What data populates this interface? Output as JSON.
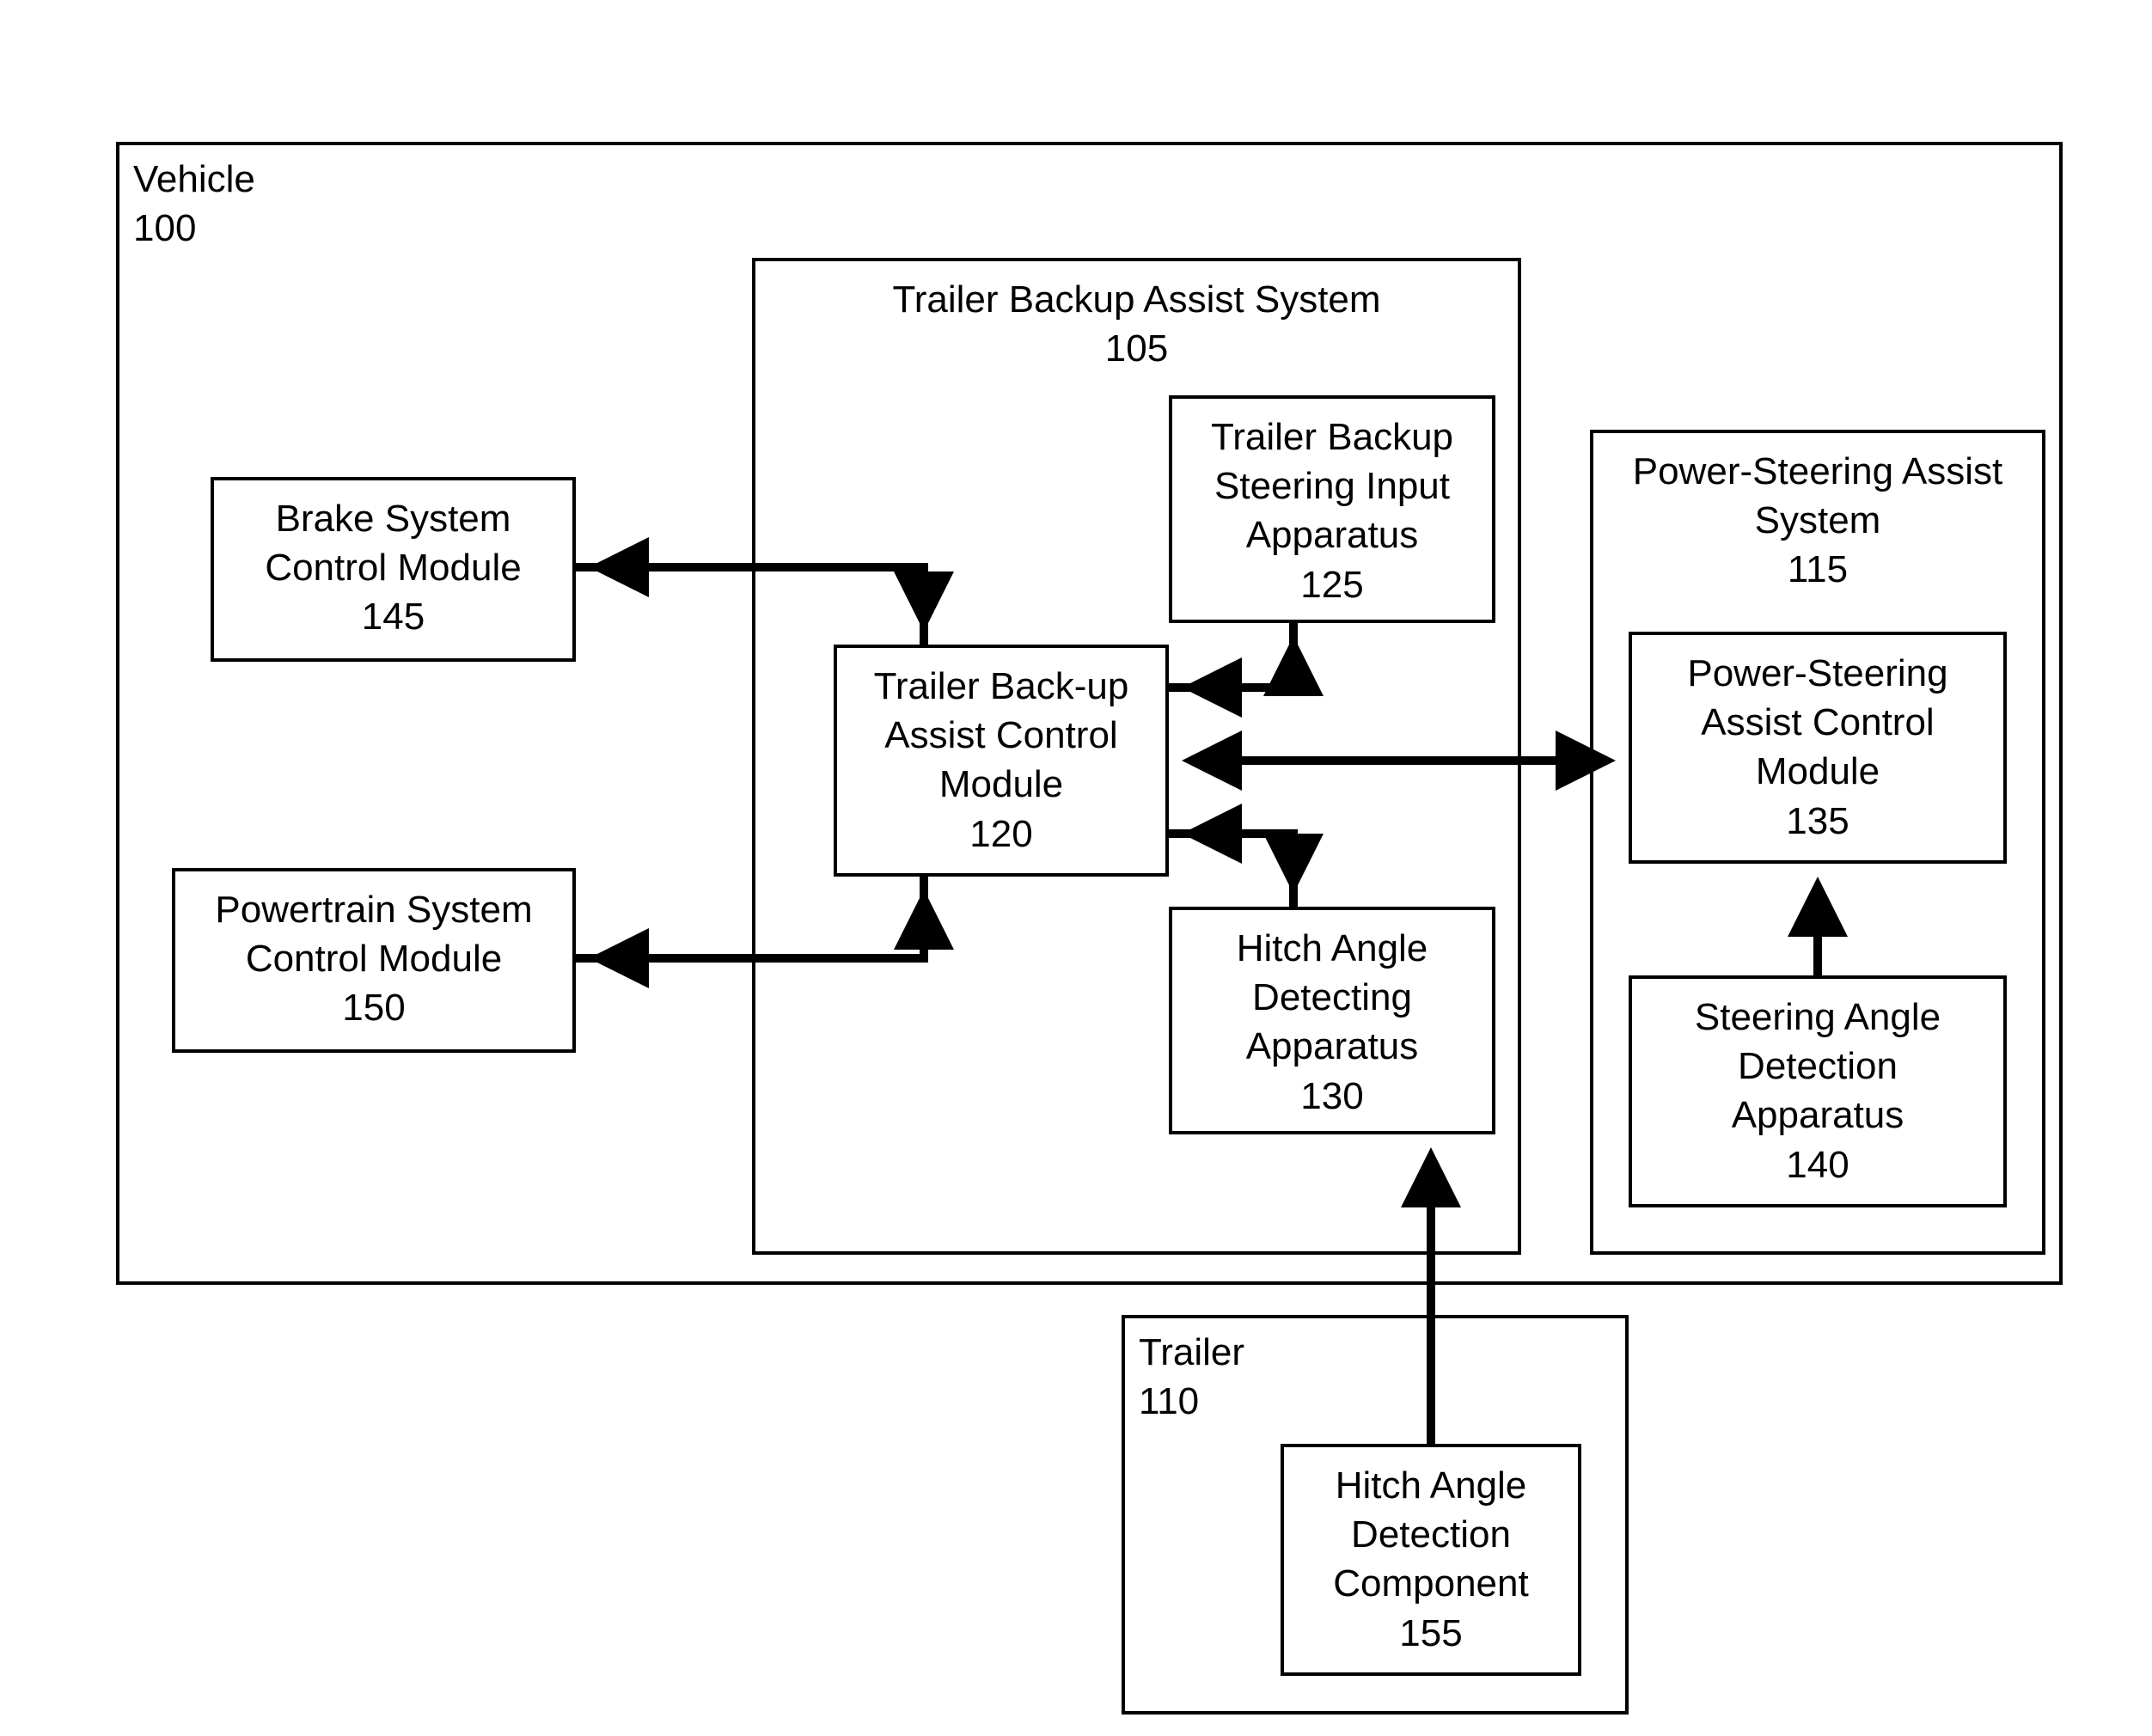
{
  "vehicle": {
    "title": "Vehicle",
    "num": "100"
  },
  "trailerBackupSystem": {
    "title": "Trailer Backup Assist System",
    "num": "105"
  },
  "trailerBackupSteeringInput": {
    "line1": "Trailer Backup",
    "line2": "Steering Input",
    "line3": "Apparatus",
    "num": "125"
  },
  "trailerBackupControl": {
    "line1": "Trailer Back-up",
    "line2": "Assist Control",
    "line3": "Module",
    "num": "120"
  },
  "hitchAngleDetecting": {
    "line1": "Hitch Angle",
    "line2": "Detecting",
    "line3": "Apparatus",
    "num": "130"
  },
  "brakeSystem": {
    "line1": "Brake System",
    "line2": "Control Module",
    "num": "145"
  },
  "powertrainSystem": {
    "line1": "Powertrain System",
    "line2": "Control Module",
    "num": "150"
  },
  "powerSteeringSystem": {
    "line1": "Power-Steering Assist",
    "line2": "System",
    "num": "115"
  },
  "powerSteeringControl": {
    "line1": "Power-Steering",
    "line2": "Assist Control",
    "line3": "Module",
    "num": "135"
  },
  "steeringAngleDetection": {
    "line1": "Steering Angle",
    "line2": "Detection",
    "line3": "Apparatus",
    "num": "140"
  },
  "trailer": {
    "title": "Trailer",
    "num": "110"
  },
  "hitchAngleComponent": {
    "line1": "Hitch Angle",
    "line2": "Detection",
    "line3": "Component",
    "num": "155"
  }
}
